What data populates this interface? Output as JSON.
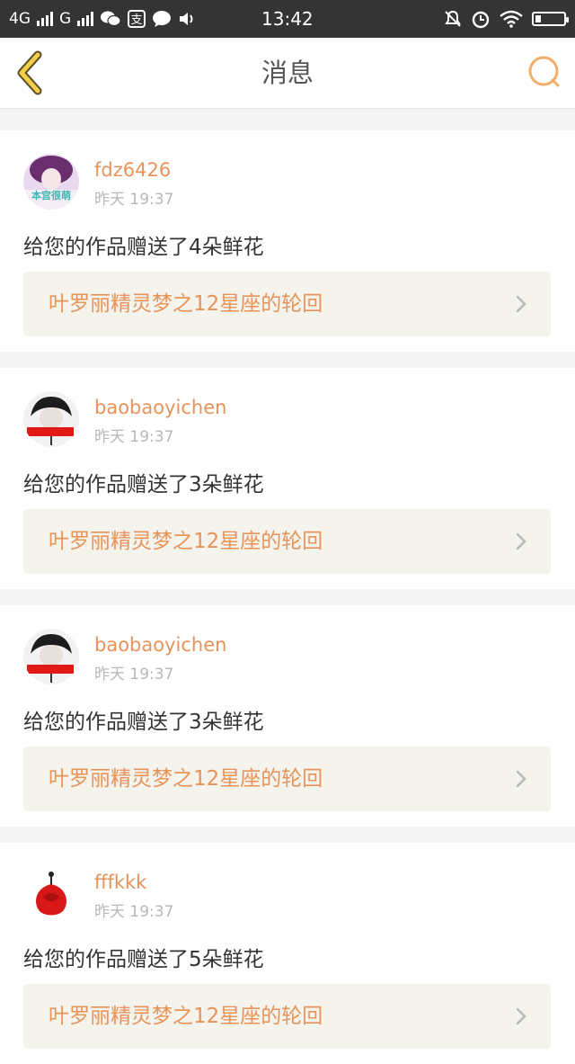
{
  "status_bar": {
    "network_1": "4G",
    "network_2": "G",
    "time": "13:42",
    "icons": [
      "signal-icon",
      "wechat-icon",
      "alipay-icon",
      "message-icon",
      "volume-icon",
      "mute-icon",
      "alarm-icon",
      "wifi-icon",
      "battery-icon"
    ]
  },
  "header": {
    "title": "消息",
    "back_icon": "back-chevron-icon",
    "search_icon": "search-icon",
    "accent_color": "#f0b06a"
  },
  "colors": {
    "username": "#e8935a",
    "link_bg": "#f4f3ec",
    "text": "#333333",
    "muted": "#b7b7b7"
  },
  "messages": [
    {
      "username": "fdz6426",
      "time": "昨天 19:37",
      "text": "给您的作品赠送了4朵鲜花",
      "work_title": "叶罗丽精灵梦之12星座的轮回",
      "avatar_label": "本宫很萌"
    },
    {
      "username": "baobaoyichen",
      "time": "昨天 19:37",
      "text": "给您的作品赠送了3朵鲜花",
      "work_title": "叶罗丽精灵梦之12星座的轮回",
      "avatar_label": ""
    },
    {
      "username": "baobaoyichen",
      "time": "昨天 19:37",
      "text": "给您的作品赠送了3朵鲜花",
      "work_title": "叶罗丽精灵梦之12星座的轮回",
      "avatar_label": ""
    },
    {
      "username": "fffkkk",
      "time": "昨天 19:37",
      "text": "给您的作品赠送了5朵鲜花",
      "work_title": "叶罗丽精灵梦之12星座的轮回",
      "avatar_label": ""
    }
  ]
}
